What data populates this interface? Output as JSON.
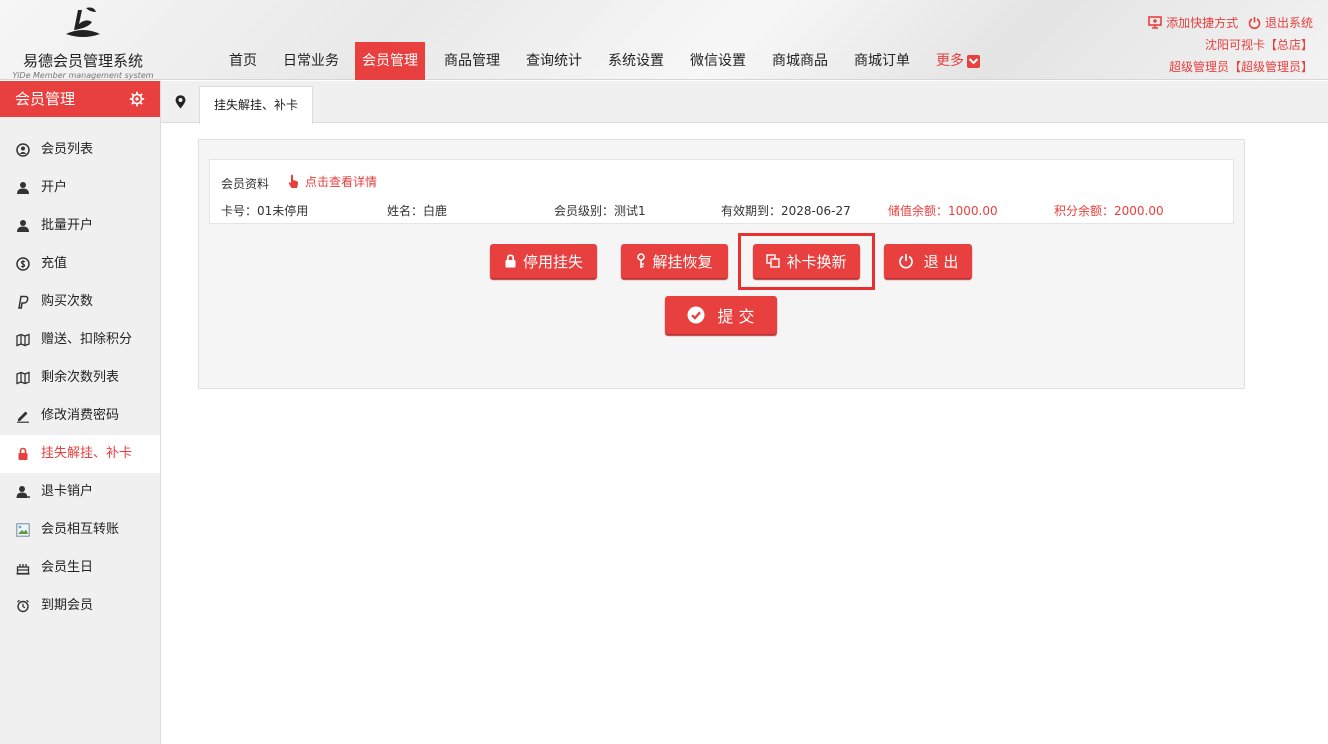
{
  "brand": {
    "title": "易德会员管理系统",
    "subtitle": "YiDe Member management system"
  },
  "nav": {
    "items": [
      "首页",
      "日常业务",
      "会员管理",
      "商品管理",
      "查询统计",
      "系统设置",
      "微信设置",
      "商城商品",
      "商城订单"
    ],
    "active": "会员管理",
    "more_label": "更多"
  },
  "top_right": {
    "add_shortcut": "添加快捷方式",
    "logout": "退出系统",
    "store": "沈阳可视卡【总店】",
    "user": "超级管理员【超级管理员】"
  },
  "sidebar": {
    "title": "会员管理",
    "items": [
      {
        "label": "会员列表",
        "icon": "user-circle-icon"
      },
      {
        "label": "开户",
        "icon": "user-icon"
      },
      {
        "label": "批量开户",
        "icon": "user-icon"
      },
      {
        "label": "充值",
        "icon": "coin-icon"
      },
      {
        "label": "购买次数",
        "icon": "paypal-icon"
      },
      {
        "label": "赠送、扣除积分",
        "icon": "map-icon"
      },
      {
        "label": "剩余次数列表",
        "icon": "map-icon"
      },
      {
        "label": "修改消费密码",
        "icon": "pencil-icon"
      },
      {
        "label": "挂失解挂、补卡",
        "icon": "lock-icon"
      },
      {
        "label": "退卡销户",
        "icon": "user-minus-icon"
      },
      {
        "label": "会员相互转账",
        "icon": "image-icon"
      },
      {
        "label": "会员生日",
        "icon": "cake-icon"
      },
      {
        "label": "到期会员",
        "icon": "alarm-icon"
      }
    ],
    "active_index": 8
  },
  "tabs": {
    "current": "挂失解挂、补卡"
  },
  "member": {
    "section_title": "会员资料",
    "detail_link": "点击查看详情",
    "card_no": "卡号：01未停用",
    "name": "姓名：白鹿",
    "level": "会员级别：测试1",
    "expiry": "有效期到：2028-06-27",
    "balance": "储值余额：1000.00",
    "points": "积分余额：2000.00"
  },
  "actions": {
    "suspend": "停用挂失",
    "restore": "解挂恢复",
    "replace": "补卡换新",
    "exit": "退 出",
    "submit": "提 交"
  },
  "colors": {
    "accent": "#e7403f",
    "sidebar_bg": "#f0f0f0"
  }
}
